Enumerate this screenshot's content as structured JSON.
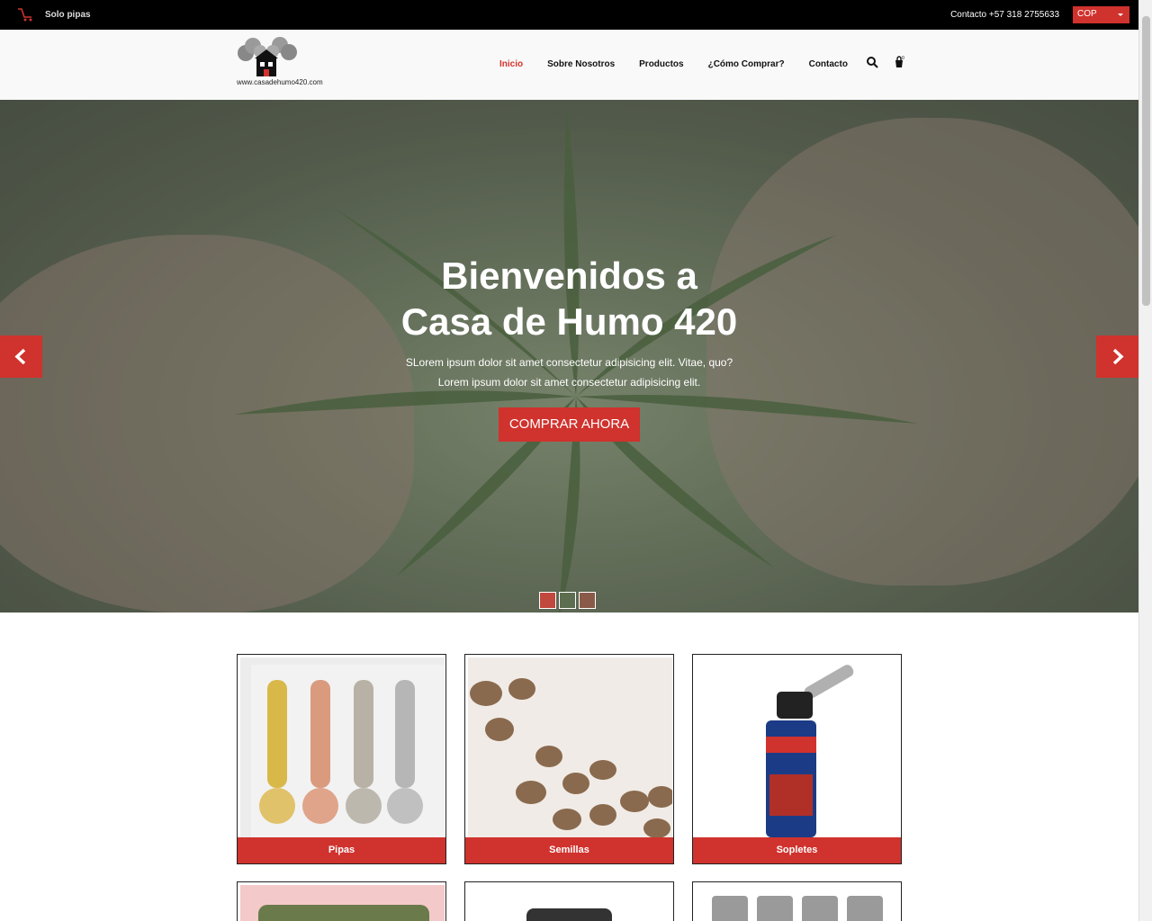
{
  "topbar": {
    "ticker_text": "Solo pipas",
    "contact": "Contacto +57 318 2755633",
    "currency": "COP"
  },
  "header": {
    "logo_url": "www.casadehumo420.com",
    "nav": [
      {
        "label": "Inicio",
        "active": true
      },
      {
        "label": "Sobre Nosotros",
        "active": false
      },
      {
        "label": "Productos",
        "active": false
      },
      {
        "label": "¿Cómo Comprar?",
        "active": false
      },
      {
        "label": "Contacto",
        "active": false
      }
    ],
    "cart_count": "0"
  },
  "hero": {
    "title_line1": "Bienvenidos a",
    "title_line2": "Casa de Humo 420",
    "sub_line1": "SLorem ipsum dolor sit amet consectetur adipisicing elit. Vitae, quo?",
    "sub_line2": "Lorem ipsum dolor sit amet consectetur adipisicing elit.",
    "cta": "COMPRAR AHORA",
    "slides": 3,
    "active_slide": 1
  },
  "products": [
    {
      "label": "Pipas"
    },
    {
      "label": "Semillas"
    },
    {
      "label": "Sopletes"
    },
    {
      "label": ""
    },
    {
      "label": ""
    },
    {
      "label": ""
    }
  ],
  "colors": {
    "accent": "#d0322d",
    "topbar": "#000000",
    "header": "#f9f9f9"
  }
}
